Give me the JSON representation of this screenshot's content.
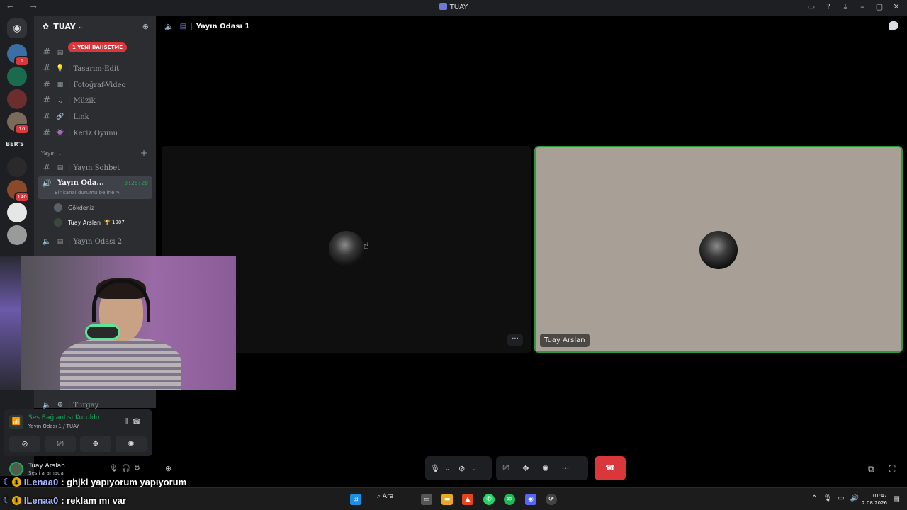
{
  "window": {
    "title": "TUAY",
    "nav": "← →"
  },
  "server": {
    "name": "TUAY",
    "mention_pill": "1 YENİ BAHSETME"
  },
  "rail": {
    "badges": [
      "1",
      "10",
      "140"
    ],
    "text_server": "BER'S"
  },
  "channels": [
    {
      "emoji": "▤",
      "name": ""
    },
    {
      "emoji": "💡",
      "name": "Tasarım-Edit"
    },
    {
      "emoji": "▦",
      "name": "Fotoğraf-Video"
    },
    {
      "emoji": "♫",
      "name": "Müzik"
    },
    {
      "emoji": "🔗",
      "name": "Link"
    },
    {
      "emoji": "👾",
      "name": "Keriz Oyunu"
    }
  ],
  "category": {
    "label": "Yayın ⌄",
    "plus": "+"
  },
  "stream_channels": [
    {
      "emoji": "▤",
      "name": "Yayın Sohbet"
    }
  ],
  "active_voice": {
    "name": "Yayın Oda...",
    "timer": "3:28:28",
    "status": "Bir kanal durumu belirle ✎",
    "users": [
      {
        "name": "Gökdeniz"
      },
      {
        "name": "Tuay Arslan",
        "trophy": "🏆 1907"
      }
    ]
  },
  "other_voice": [
    {
      "name": "Yayın Odası 2"
    },
    {
      "name": "Turgay"
    }
  ],
  "voice_panel": {
    "title": "Ses Bağlantısı Kuruldu",
    "subtitle": "Yayın Odası 1 / TUAY"
  },
  "user_panel": {
    "name": "Tuay Arslan",
    "status": "Sesli aramada"
  },
  "main": {
    "channel_title": "Yayın Odası 1",
    "tile_right_name": "Tuay Arslan",
    "tile_dots": "···"
  },
  "chat_overlay": [
    {
      "user": "ILenaa0",
      "text": ": ghjkl yapıyorum yapıyorum"
    },
    {
      "user": "ILenaa0",
      "text": ": reklam mı var"
    }
  ],
  "taskbar": {
    "search": "Ara",
    "time": "01:47",
    "date": "2.08.2026"
  },
  "colors": {
    "accent_green": "#23a55a",
    "danger_red": "#da373c",
    "blurple": "#5865f2"
  }
}
